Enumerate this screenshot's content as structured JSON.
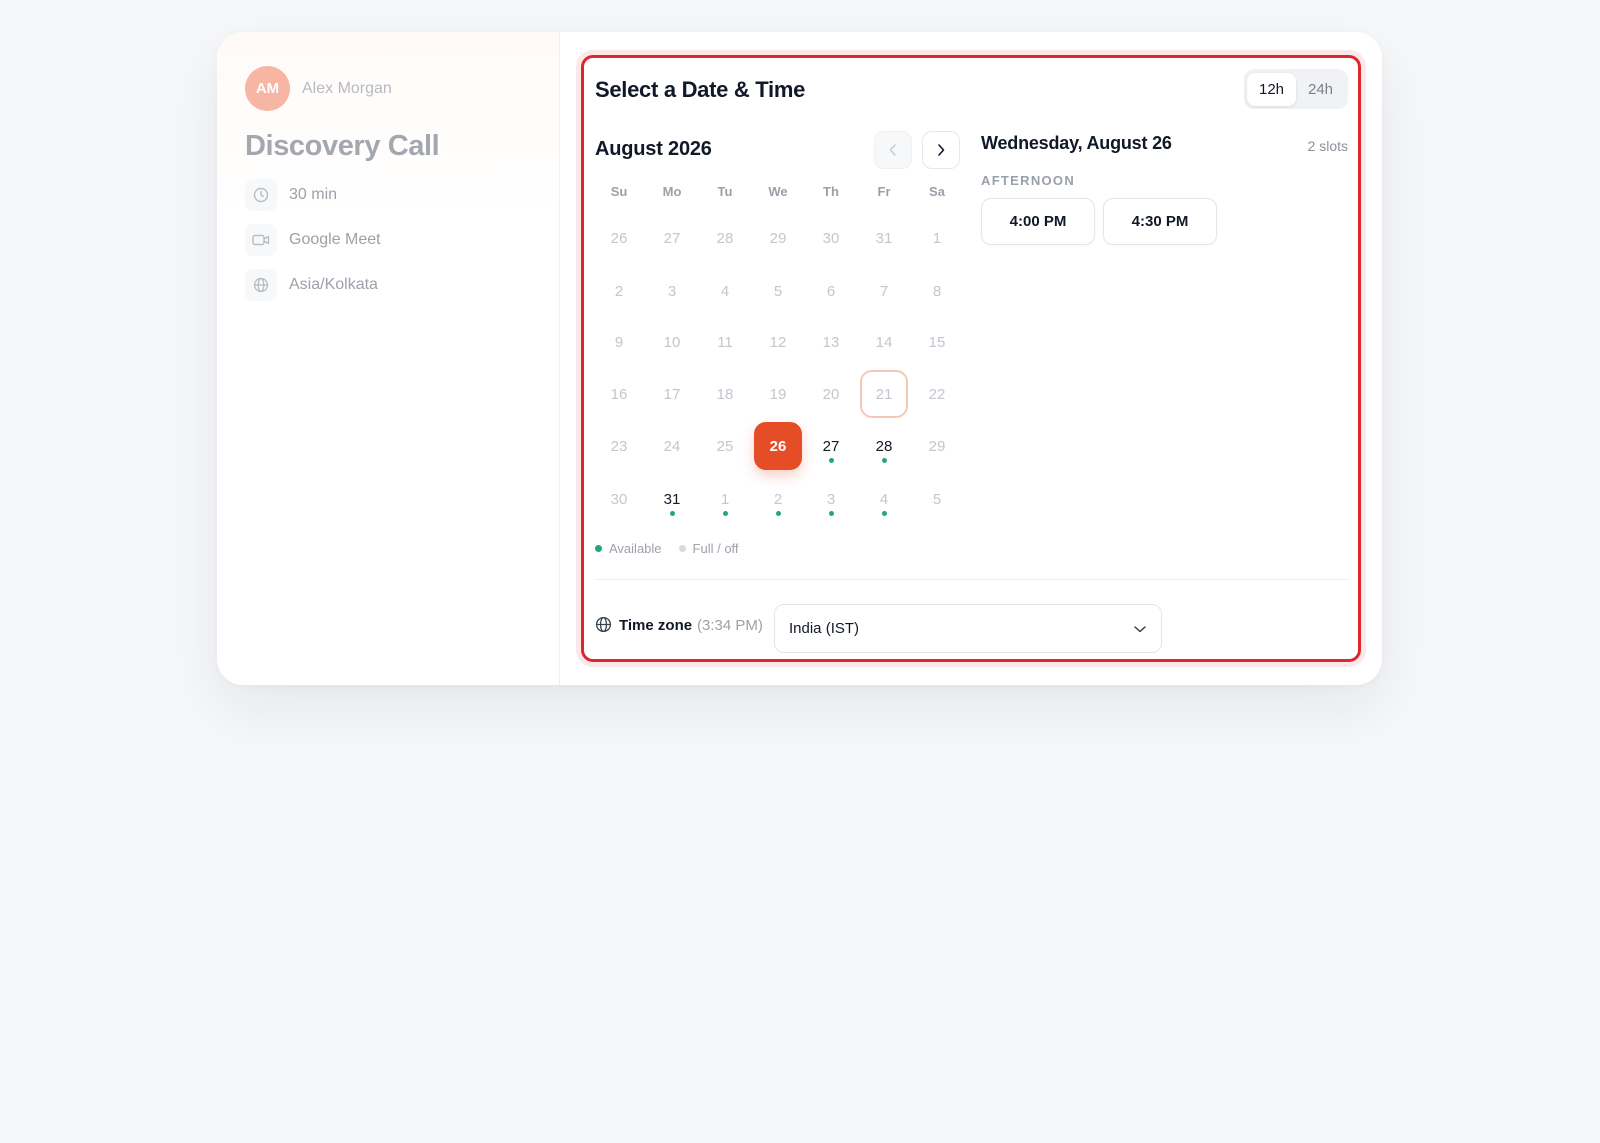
{
  "host": {
    "initials": "AM",
    "name": "Alex Morgan"
  },
  "event": {
    "title": "Discovery Call",
    "meta": [
      {
        "icon": "clock-icon",
        "label": "30 min"
      },
      {
        "icon": "video-icon",
        "label": "Google Meet"
      },
      {
        "icon": "globe-icon",
        "label": "Asia/Kolkata"
      }
    ]
  },
  "scheduler": {
    "title": "Select a Date & Time",
    "format_options": [
      "12h",
      "24h"
    ],
    "format_selected": "12h",
    "month_label": "August 2026",
    "weekdays": [
      "Su",
      "Mo",
      "Tu",
      "We",
      "Th",
      "Fr",
      "Sa"
    ],
    "weeks": [
      [
        {
          "d": "26"
        },
        {
          "d": "27"
        },
        {
          "d": "28"
        },
        {
          "d": "29"
        },
        {
          "d": "30"
        },
        {
          "d": "31"
        },
        {
          "d": "1"
        }
      ],
      [
        {
          "d": "2"
        },
        {
          "d": "3"
        },
        {
          "d": "4"
        },
        {
          "d": "5"
        },
        {
          "d": "6"
        },
        {
          "d": "7"
        },
        {
          "d": "8"
        }
      ],
      [
        {
          "d": "9"
        },
        {
          "d": "10"
        },
        {
          "d": "11"
        },
        {
          "d": "12"
        },
        {
          "d": "13"
        },
        {
          "d": "14"
        },
        {
          "d": "15"
        }
      ],
      [
        {
          "d": "16"
        },
        {
          "d": "17"
        },
        {
          "d": "18"
        },
        {
          "d": "19"
        },
        {
          "d": "20"
        },
        {
          "d": "21",
          "today": true
        },
        {
          "d": "22"
        }
      ],
      [
        {
          "d": "23"
        },
        {
          "d": "24"
        },
        {
          "d": "25"
        },
        {
          "d": "26",
          "selected": true
        },
        {
          "d": "27",
          "avail": true,
          "dot": true
        },
        {
          "d": "28",
          "avail": true,
          "dot": true
        },
        {
          "d": "29"
        }
      ],
      [
        {
          "d": "30"
        },
        {
          "d": "31",
          "avail": true,
          "dot": true
        },
        {
          "d": "1",
          "dot": true
        },
        {
          "d": "2",
          "dot": true
        },
        {
          "d": "3",
          "dot": true
        },
        {
          "d": "4",
          "dot": true
        },
        {
          "d": "5"
        }
      ]
    ],
    "legend": {
      "available": "Available",
      "unavailable": "Full / off"
    },
    "selected_date_label": "Wednesday, August 26",
    "slot_count": "2 slots",
    "slot_group": "AFTERNOON",
    "slots": [
      "4:00 PM",
      "4:30 PM"
    ],
    "timezone": {
      "label": "Time zone",
      "current_time": "(3:34 PM)",
      "selected": "India (IST)"
    }
  },
  "colors": {
    "accent": "#e44d26",
    "available_dot": "#22a67a",
    "unavailable_dot": "#d1d5db",
    "highlight_border": "#dc2630"
  }
}
